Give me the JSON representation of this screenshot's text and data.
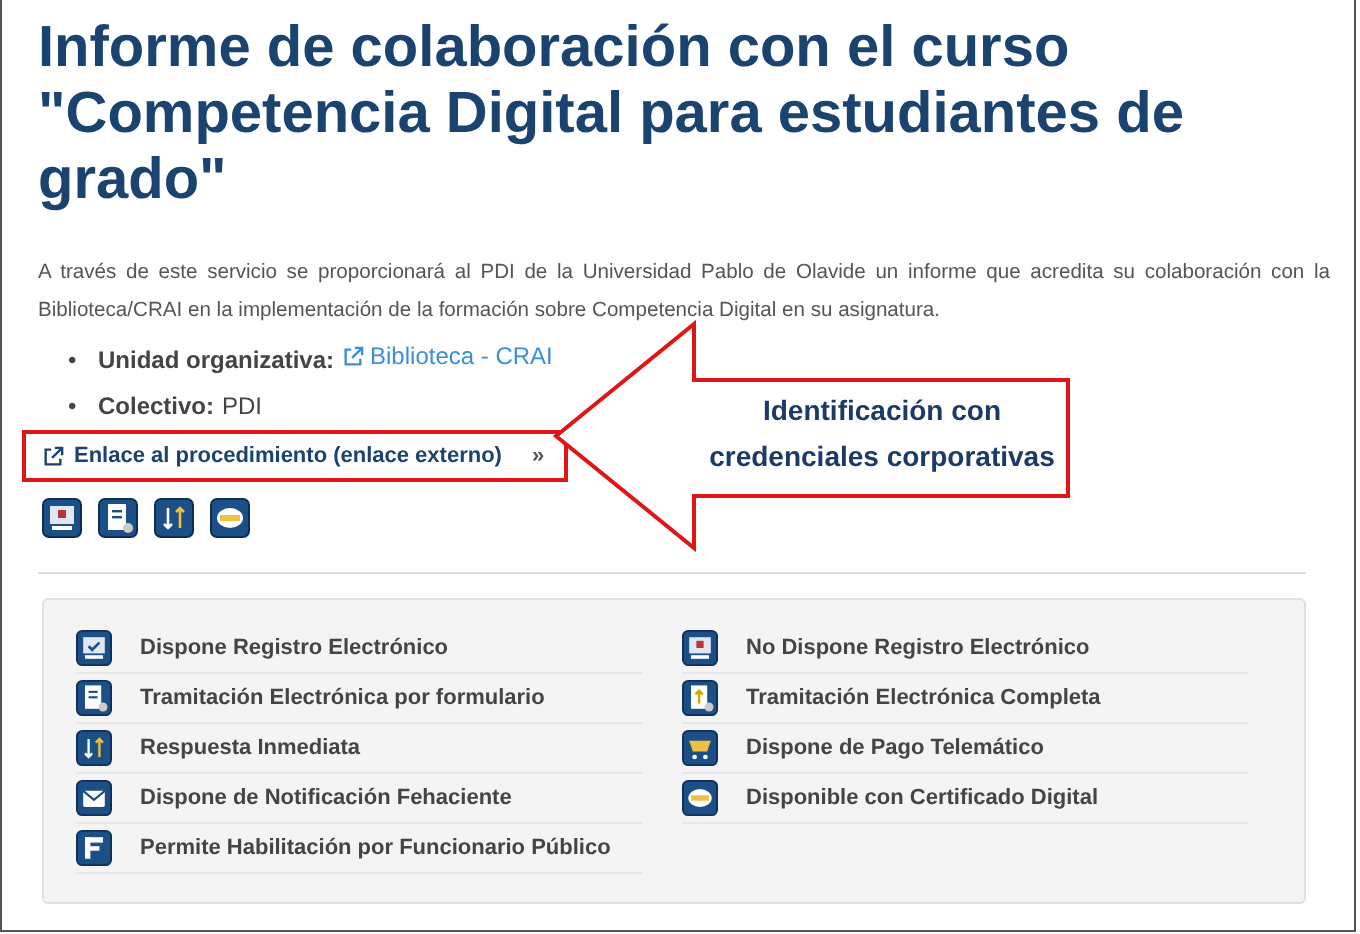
{
  "title": "Informe de colaboración con el curso \"Competencia Digital para estudiantes de grado\"",
  "description": "A través de este servicio se proporcionará al PDI de la Universidad Pablo de Olavide un informe que acredita su colaboración con la Biblioteca/CRAI en la implementación de la formación sobre Competencia Digital en su asignatura.",
  "details": [
    {
      "bullet": "•",
      "label": "Unidad organizativa:",
      "value": "Biblioteca - CRAI",
      "kind": "link"
    },
    {
      "bullet": "•",
      "label": "Colectivo:",
      "value": "PDI",
      "kind": "text"
    }
  ],
  "procedure_link": {
    "text": "Enlace al procedimiento (enlace externo)",
    "chevron": "»"
  },
  "feature_icons": [
    {
      "kind": "monitor-x"
    },
    {
      "kind": "document"
    },
    {
      "kind": "arrows"
    },
    {
      "kind": "certificate"
    }
  ],
  "annotation": {
    "text": "Identificación con credenciales corporativas"
  },
  "legend": [
    {
      "kind": "monitor-check",
      "label": "Dispone Registro Electrónico"
    },
    {
      "kind": "monitor-x",
      "label": "No Dispone Registro Electrónico"
    },
    {
      "kind": "document",
      "label": "Tramitación Electrónica por formulario"
    },
    {
      "kind": "document-up",
      "label": "Tramitación Electrónica Completa"
    },
    {
      "kind": "arrows",
      "label": "Respuesta Inmediata"
    },
    {
      "kind": "cart",
      "label": "Dispone de Pago Telemático"
    },
    {
      "kind": "envelope",
      "label": "Dispone de Notificación Fehaciente"
    },
    {
      "kind": "certificate",
      "label": "Disponible con Certificado Digital"
    },
    {
      "kind": "letter-f",
      "label": "Permite Habilitación por Funcionario Público"
    }
  ]
}
